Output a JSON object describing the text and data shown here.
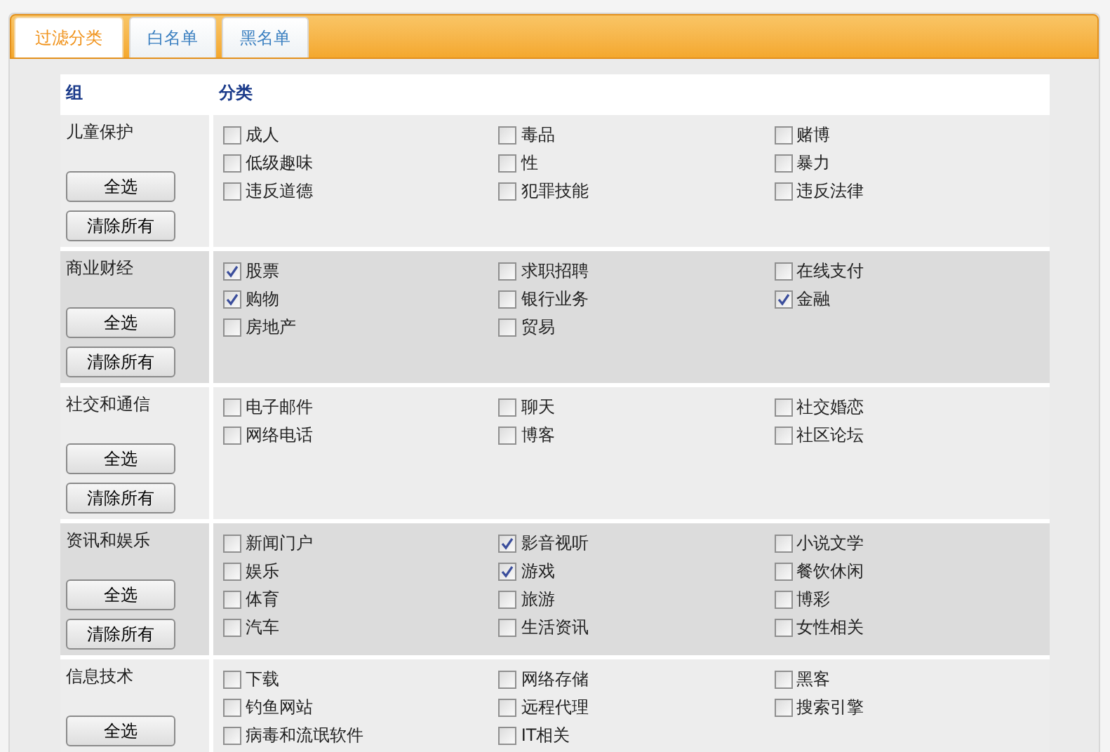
{
  "tabs": [
    {
      "label": "过滤分类",
      "selected": true
    },
    {
      "label": "白名单",
      "selected": false
    },
    {
      "label": "黑名单",
      "selected": false
    }
  ],
  "table": {
    "columns": [
      "组",
      "分类"
    ],
    "groups": [
      {
        "name": "儿童保护",
        "buttons": [
          "全选",
          "清除所有"
        ],
        "categories": [
          {
            "label": "成人",
            "checked": false
          },
          {
            "label": "毒品",
            "checked": false
          },
          {
            "label": "赌博",
            "checked": false
          },
          {
            "label": "低级趣味",
            "checked": false
          },
          {
            "label": "性",
            "checked": false
          },
          {
            "label": "暴力",
            "checked": false
          },
          {
            "label": "违反道德",
            "checked": false
          },
          {
            "label": "犯罪技能",
            "checked": false
          },
          {
            "label": "违反法律",
            "checked": false
          }
        ]
      },
      {
        "name": "商业财经",
        "buttons": [
          "全选",
          "清除所有"
        ],
        "categories": [
          {
            "label": "股票",
            "checked": true
          },
          {
            "label": "求职招聘",
            "checked": false
          },
          {
            "label": "在线支付",
            "checked": false
          },
          {
            "label": "购物",
            "checked": true
          },
          {
            "label": "银行业务",
            "checked": false
          },
          {
            "label": "金融",
            "checked": true
          },
          {
            "label": "房地产",
            "checked": false
          },
          {
            "label": "贸易",
            "checked": false
          }
        ]
      },
      {
        "name": "社交和通信",
        "buttons": [
          "全选",
          "清除所有"
        ],
        "categories": [
          {
            "label": "电子邮件",
            "checked": false
          },
          {
            "label": "聊天",
            "checked": false
          },
          {
            "label": "社交婚恋",
            "checked": false
          },
          {
            "label": "网络电话",
            "checked": false
          },
          {
            "label": "博客",
            "checked": false
          },
          {
            "label": "社区论坛",
            "checked": false
          }
        ]
      },
      {
        "name": "资讯和娱乐",
        "buttons": [
          "全选",
          "清除所有"
        ],
        "categories": [
          {
            "label": "新闻门户",
            "checked": false
          },
          {
            "label": "影音视听",
            "checked": true
          },
          {
            "label": "小说文学",
            "checked": false
          },
          {
            "label": "娱乐",
            "checked": false
          },
          {
            "label": "游戏",
            "checked": true
          },
          {
            "label": "餐饮休闲",
            "checked": false
          },
          {
            "label": "体育",
            "checked": false
          },
          {
            "label": "旅游",
            "checked": false
          },
          {
            "label": "博彩",
            "checked": false
          },
          {
            "label": "汽车",
            "checked": false
          },
          {
            "label": "生活资讯",
            "checked": false
          },
          {
            "label": "女性相关",
            "checked": false
          }
        ]
      },
      {
        "name": "信息技术",
        "buttons": [
          "全选"
        ],
        "categories": [
          {
            "label": "下载",
            "checked": false
          },
          {
            "label": "网络存储",
            "checked": false
          },
          {
            "label": "黑客",
            "checked": false
          },
          {
            "label": "钓鱼网站",
            "checked": false
          },
          {
            "label": "远程代理",
            "checked": false
          },
          {
            "label": "搜索引擎",
            "checked": false
          },
          {
            "label": "病毒和流氓软件",
            "checked": false
          },
          {
            "label": "IT相关",
            "checked": false
          }
        ]
      }
    ]
  }
}
